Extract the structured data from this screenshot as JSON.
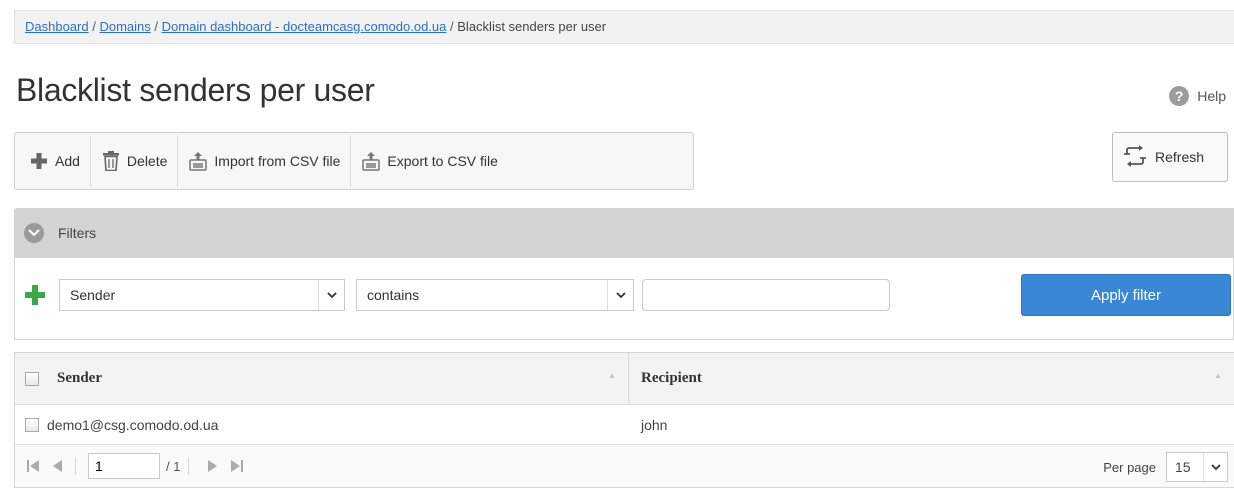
{
  "breadcrumb": {
    "items": [
      "Dashboard",
      "Domains",
      "Domain dashboard - docteamcasg.comodo.od.ua"
    ],
    "current": "Blacklist senders per user",
    "separator": "/"
  },
  "page": {
    "title": "Blacklist senders per user"
  },
  "help": {
    "label": "Help"
  },
  "toolbar": {
    "add_label": "Add",
    "delete_label": "Delete",
    "import_label": "Import from CSV file",
    "export_label": "Export to CSV file"
  },
  "refresh": {
    "label": "Refresh"
  },
  "filters": {
    "label": "Filters",
    "field_select": "Sender",
    "operator_select": "contains",
    "value": "",
    "apply_label": "Apply filter"
  },
  "table": {
    "columns": [
      "Sender",
      "Recipient"
    ],
    "rows": [
      {
        "sender": "demo1@csg.comodo.od.ua",
        "recipient": "john"
      }
    ]
  },
  "pager": {
    "page": "1",
    "total": "/ 1",
    "per_page_label": "Per page",
    "per_page_value": "15"
  },
  "colors": {
    "accent": "#3a87d6",
    "add_green": "#3aa84a",
    "link": "#2a6fc9"
  }
}
